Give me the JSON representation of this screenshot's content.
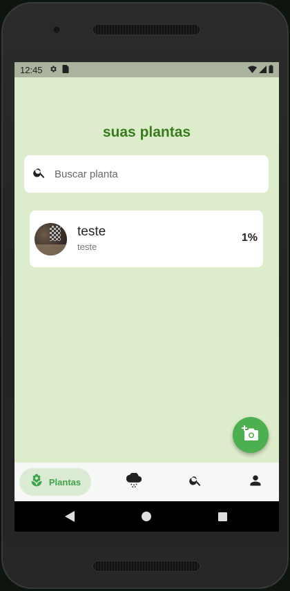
{
  "status_bar": {
    "time": "12:45",
    "icons": [
      "settings-icon",
      "sd-card-icon",
      "wifi-icon",
      "signal-icon",
      "battery-icon"
    ]
  },
  "page": {
    "title": "suas plantas"
  },
  "search": {
    "placeholder": "Buscar planta",
    "icon": "search-icon"
  },
  "plants": [
    {
      "name": "teste",
      "subtitle": "teste",
      "percentage": "1%"
    }
  ],
  "fab": {
    "icon": "add-photo-icon"
  },
  "bottom_nav": {
    "items": [
      {
        "label": "Plantas",
        "icon": "plant-icon",
        "active": true
      },
      {
        "label": "",
        "icon": "rain-cloud-icon",
        "active": false
      },
      {
        "label": "",
        "icon": "search-icon",
        "active": false
      },
      {
        "label": "",
        "icon": "person-icon",
        "active": false
      }
    ]
  },
  "system_nav": {
    "icons": [
      "back-icon",
      "home-icon",
      "recents-icon"
    ]
  },
  "colors": {
    "background": "#ddedcb",
    "title": "#3a7a1f",
    "accent": "#4caf50",
    "nav_active_bg": "#dbead3",
    "nav_active_text": "#3fa34d"
  }
}
